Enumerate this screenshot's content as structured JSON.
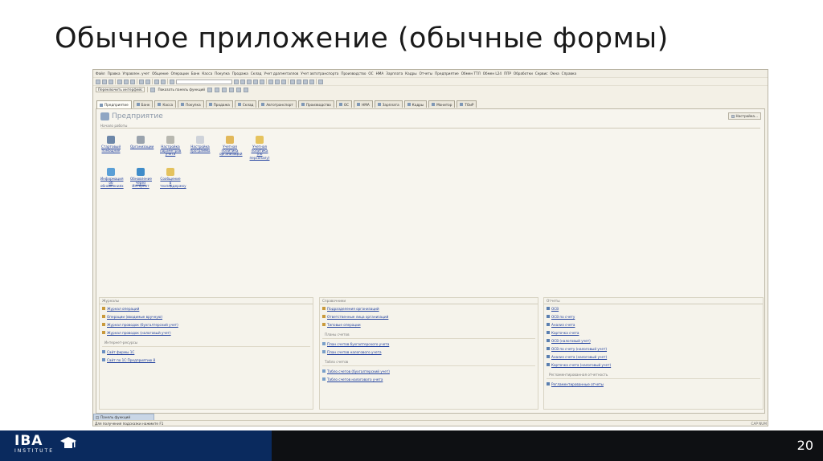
{
  "slide": {
    "title": "Обычное приложение (обычные формы)",
    "page_number": "20",
    "logo_text": "IBA",
    "logo_sub": "INSTITUTE"
  },
  "app": {
    "menu": [
      "Файл",
      "Правка",
      "Управлен. учет",
      "Общение",
      "Операции",
      "Банк",
      "Касса",
      "Покупка",
      "Продажа",
      "Склад",
      "Учет драгметаллов",
      "Учет автотранспорта",
      "Производство",
      "ОС",
      "НМА",
      "Зарплата",
      "Кадры",
      "Отчеты",
      "Предприятие",
      "Обмен ТТЛ",
      "Обмен L24",
      "ППР",
      "Обработки",
      "Сервис",
      "Окна",
      "Справка"
    ],
    "toolbar2": {
      "interface_select": "Переключить интерфейс",
      "function_panel": "Показать панель функций"
    },
    "tabs": [
      "Предприятие",
      "Банк",
      "Касса",
      "Покупка",
      "Продажа",
      "Склад",
      "Автотранспорт",
      "Производство",
      "ОС",
      "НМА",
      "Зарплата",
      "Кадры",
      "Монитор",
      "ТОиР"
    ],
    "panel": {
      "title": "Предприятие",
      "settings_button": "Настройка...",
      "start_group": "Начало работы",
      "actions": [
        {
          "label": "Стартовый помощник",
          "color": "#6d87a8"
        },
        {
          "label": "Организации",
          "color": "#9aa3ad"
        },
        {
          "label": "Настройка параметров учета",
          "color": "#b8b8b0"
        },
        {
          "label": "Настройка программы",
          "color": "#cfd3da"
        },
        {
          "label": "Учетная политика организаций",
          "color": "#e2b85a"
        },
        {
          "label": "Учетная политика (по персоналу)",
          "color": "#e6c35e"
        },
        {
          "label": "Информация об обновлениях",
          "color": "#5a9fd6"
        },
        {
          "label": "Обновление через Интернет",
          "color": "#3f8cc9"
        },
        {
          "label": "Сообщение в техподдержку",
          "color": "#e4c25d"
        }
      ]
    },
    "journals": {
      "title": "Журналы",
      "items": [
        "Журнал операций",
        "Операции (вводимые вручную)",
        "Журнал проводок (бухгалтерский учет)",
        "Журнал проводок (налоговый учет)"
      ],
      "internet_title": "Интернет-ресурсы",
      "internet_items": [
        "Сайт фирмы 1С",
        "Сайт по 1С:Предприятию 8"
      ]
    },
    "references": {
      "title": "Справочники",
      "items": [
        "Подразделения организаций",
        "Ответственные лица организаций",
        "Типовые операции"
      ],
      "plans_title": "Планы счетов",
      "plans_items": [
        "План счетов бухгалтерского учета",
        "План счетов налогового учета"
      ],
      "tables_title": "Табло счетов",
      "tables_items": [
        "Табло счетов (бухгалтерский учет)",
        "Табло счетов налогового учета"
      ]
    },
    "reports": {
      "title": "Отчеты",
      "items": [
        "ОСВ",
        "ОСВ по счету",
        "Анализ счета",
        "Карточка счета",
        "ОСВ (налоговый учет)",
        "ОСВ по счету (налоговый учет)",
        "Анализ счета (налоговый учет)",
        "Карточка счета (налоговый учет)"
      ],
      "regulated_title": "Регламентированная отчетность",
      "regulated_items": [
        "Регламентированные отчеты"
      ]
    },
    "bottom_panel": "Панель функций",
    "status_hint": "Для получения подсказки нажмите F1",
    "status_right": "CAP  NUM"
  }
}
